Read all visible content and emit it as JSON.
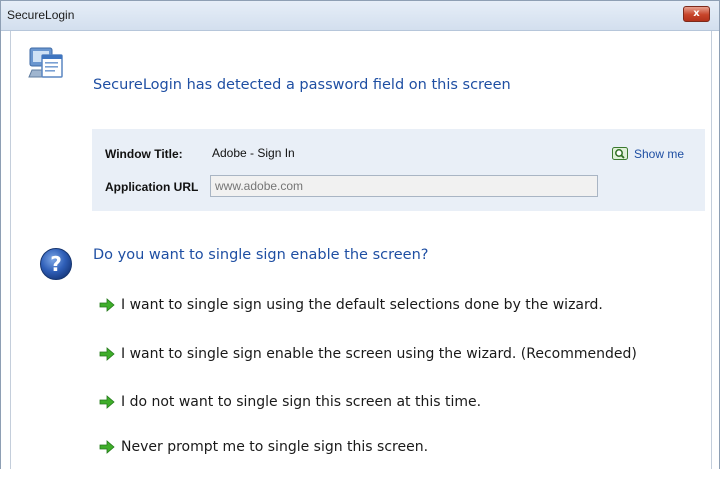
{
  "window": {
    "title": "SecureLogin",
    "close_label": "x"
  },
  "detect": {
    "icon": "monitor-window-icon",
    "heading": "SecureLogin has detected a password field on this screen"
  },
  "info": {
    "window_title_label": "Window Title:",
    "window_title_value": "Adobe - Sign In",
    "app_url_label": "Application URL",
    "app_url_placeholder": "www.adobe.com",
    "app_url_value": "",
    "show_me_icon": "magnifier-screen-icon",
    "show_me_label": "Show me"
  },
  "question": {
    "icon": "question-circle-icon",
    "heading": "Do you want to single sign enable the screen?"
  },
  "options": [
    {
      "icon": "green-arrow-icon",
      "label": "I want to single sign using the default selections done by the wizard."
    },
    {
      "icon": "green-arrow-icon",
      "label": "I want to single sign enable the screen using the wizard. (Recommended)"
    },
    {
      "icon": "green-arrow-icon",
      "label": "I do not want to single sign this screen at this time."
    },
    {
      "icon": "green-arrow-icon",
      "label": "Never prompt me to single sign this screen."
    }
  ],
  "colors": {
    "heading_blue": "#1f4fa3",
    "panel_bg": "#e9eff7",
    "arrow_green": "#3fae2a",
    "close_red": "#c7442a"
  }
}
